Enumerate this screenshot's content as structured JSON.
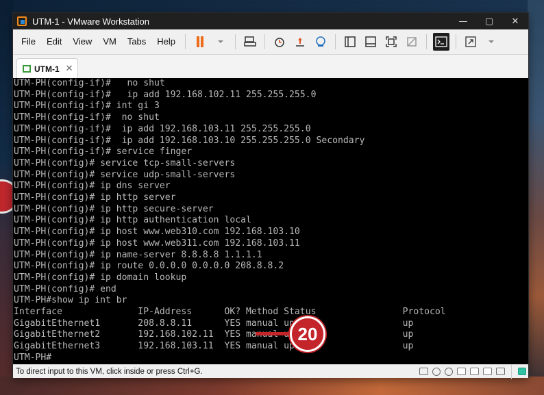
{
  "window": {
    "title": "UTM-1 - VMware Workstation",
    "controls": [
      "—",
      "▢",
      "✕"
    ]
  },
  "menu": [
    "File",
    "Edit",
    "View",
    "VM",
    "Tabs",
    "Help"
  ],
  "tab": {
    "label": "UTM-1",
    "close": "✕"
  },
  "console_lines": [
    "UTM-PH(config-if)#   no shut",
    "UTM-PH(config-if)#   ip add 192.168.102.11 255.255.255.0",
    "UTM-PH(config-if)# int gi 3",
    "UTM-PH(config-if)#  no shut",
    "UTM-PH(config-if)#  ip add 192.168.103.11 255.255.255.0",
    "UTM-PH(config-if)#  ip add 192.168.103.10 255.255.255.0 Secondary",
    "UTM-PH(config-if)# service finger",
    "UTM-PH(config)# service tcp-small-servers",
    "UTM-PH(config)# service udp-small-servers",
    "UTM-PH(config)# ip dns server",
    "UTM-PH(config)# ip http server",
    "UTM-PH(config)# ip http secure-server",
    "UTM-PH(config)# ip http authentication local",
    "UTM-PH(config)# ip host www.web310.com 192.168.103.10",
    "UTM-PH(config)# ip host www.web311.com 192.168.103.11",
    "UTM-PH(config)# ip name-server 8.8.8.8 1.1.1.1",
    "UTM-PH(config)# ip route 0.0.0.0 0.0.0.0 208.8.8.2",
    "UTM-PH(config)# ip domain lookup",
    "UTM-PH(config)# end",
    "UTM-PH#show ip int br",
    "Interface              IP-Address      OK? Method Status                Protocol",
    "GigabitEthernet1       208.8.8.11      YES manual up                    up",
    "GigabitEthernet2       192.168.102.11  YES manual up                    up",
    "GigabitEthernet3       192.168.103.11  YES manual up                    up",
    "UTM-PH#"
  ],
  "status": {
    "text": "To direct input to this VM, click inside or press Ctrl+G."
  },
  "marker": {
    "number": "20"
  },
  "colors": {
    "pause": "#ef6b1a",
    "marker": "#c3252b",
    "console_bg": "#000000",
    "console_fg": "#b9b9b9"
  }
}
